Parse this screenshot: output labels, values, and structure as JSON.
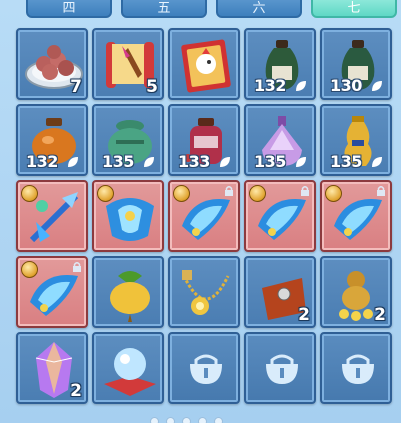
{
  "tabs": [
    {
      "label": "四",
      "active": false
    },
    {
      "label": "五",
      "active": false
    },
    {
      "label": "六",
      "active": false
    },
    {
      "label": "七",
      "active": true
    }
  ],
  "slots": [
    {
      "item": "meatballs-plate",
      "quantity": "7",
      "price": ""
    },
    {
      "item": "scroll-with-brush",
      "quantity": "5",
      "price": ""
    },
    {
      "item": "rooster-card",
      "quantity": "",
      "price": ""
    },
    {
      "item": "green-wine-jar",
      "quantity": "",
      "price": "132"
    },
    {
      "item": "green-wine-jar",
      "quantity": "",
      "price": "130"
    },
    {
      "item": "orange-jar",
      "quantity": "",
      "price": "132"
    },
    {
      "item": "jade-incense-pot",
      "quantity": "",
      "price": "135"
    },
    {
      "item": "red-wine-jar",
      "quantity": "",
      "price": "133"
    },
    {
      "item": "purple-perfume-bottle",
      "quantity": "",
      "price": "135"
    },
    {
      "item": "golden-vase",
      "quantity": "",
      "price": "135"
    },
    {
      "item": "blue-spear-weapon",
      "quantity": "",
      "price": ""
    },
    {
      "item": "blue-armor-gear",
      "quantity": "",
      "price": ""
    },
    {
      "item": "blue-fan-gear",
      "quantity": "",
      "price": ""
    },
    {
      "item": "blue-fan-gear",
      "quantity": "",
      "price": ""
    },
    {
      "item": "blue-fan-gear",
      "quantity": "",
      "price": ""
    },
    {
      "item": "blue-fan-gear",
      "quantity": "",
      "price": ""
    },
    {
      "item": "golden-gourd-fruit",
      "quantity": "",
      "price": ""
    },
    {
      "item": "gold-chain-necklace",
      "quantity": "",
      "price": ""
    },
    {
      "item": "leather-pouch",
      "quantity": "2",
      "price": ""
    },
    {
      "item": "gold-coin-gourd",
      "quantity": "2",
      "price": ""
    },
    {
      "item": "purple-crystal",
      "quantity": "2",
      "price": ""
    },
    {
      "item": "crystal-ball-on-cushion",
      "quantity": "",
      "price": ""
    },
    {
      "item": "locked-slot",
      "quantity": "",
      "price": ""
    },
    {
      "item": "locked-slot",
      "quantity": "",
      "price": ""
    },
    {
      "item": "locked-slot",
      "quantity": "",
      "price": ""
    }
  ],
  "colors": {
    "slot_blue": "#4a7db2",
    "slot_red": "#d97f82",
    "tab_active": "#5fd8c5",
    "tab_inactive": "#3d7fbd"
  }
}
